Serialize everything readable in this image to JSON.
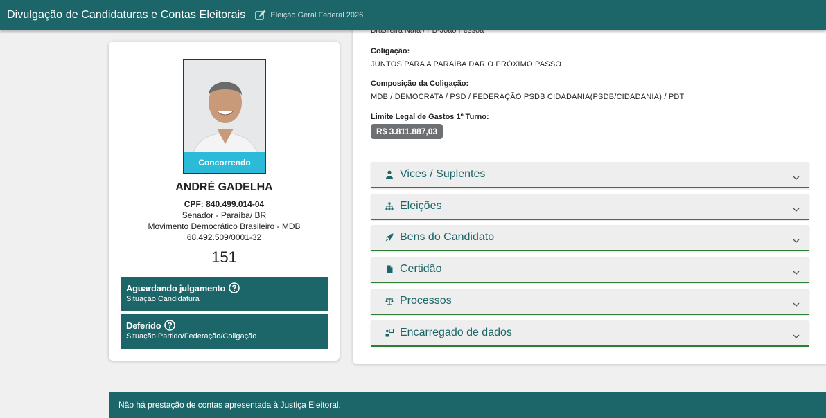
{
  "header": {
    "title": "Divulgação de Candidaturas e Contas Eleitorais",
    "election": "Eleição Geral Federal 2026"
  },
  "details": {
    "cut_line": "Brasileira Nata / PB-João Pessoa",
    "coligacao_label": "Coligação:",
    "coligacao_value": "JUNTOS PARA A PARAÍBA DAR O PRÓXIMO PASSO",
    "composicao_label": "Composição da Coligação:",
    "composicao_value": "MDB / DEMOCRATA / PSD / FEDERAÇÃO PSDB CIDADANIA(PSDB/CIDADANIA) / PDT",
    "limite_label": "Limite Legal de Gastos 1º Turno:",
    "limite_value": "R$ 3.811.887,03"
  },
  "accordion": [
    {
      "label": "Vices / Suplentes",
      "icon": "person-icon"
    },
    {
      "label": "Eleições",
      "icon": "sitemap-icon"
    },
    {
      "label": "Bens do Candidato",
      "icon": "rocket-icon"
    },
    {
      "label": "Certidão",
      "icon": "document-icon"
    },
    {
      "label": "Processos",
      "icon": "scale-icon"
    },
    {
      "label": "Encarregado de dados",
      "icon": "data-officer-icon"
    }
  ],
  "candidate": {
    "status": "Concorrendo",
    "name": "ANDRÉ GADELHA",
    "cpf": "CPF: 840.499.014-04",
    "office": "Senador - Paraíba/ BR",
    "party": "Movimento Democrático Brasileiro - MDB",
    "cnpj": "68.492.509/0001-32",
    "number": "151"
  },
  "situation": {
    "candidatura_title": "Aguardando julgamento",
    "candidatura_sub": "Situação Candidatura",
    "partido_title": "Deferido",
    "partido_sub": "Situação Partido/Federação/Coligação"
  },
  "footer": {
    "message": "Não há prestação de contas apresentada à Justiça Eleitoral."
  },
  "colors": {
    "primary": "#1c6669",
    "accent_green": "#2e7d32",
    "status_cyan": "#2bbbd8",
    "badge_gray": "#6e7173"
  }
}
